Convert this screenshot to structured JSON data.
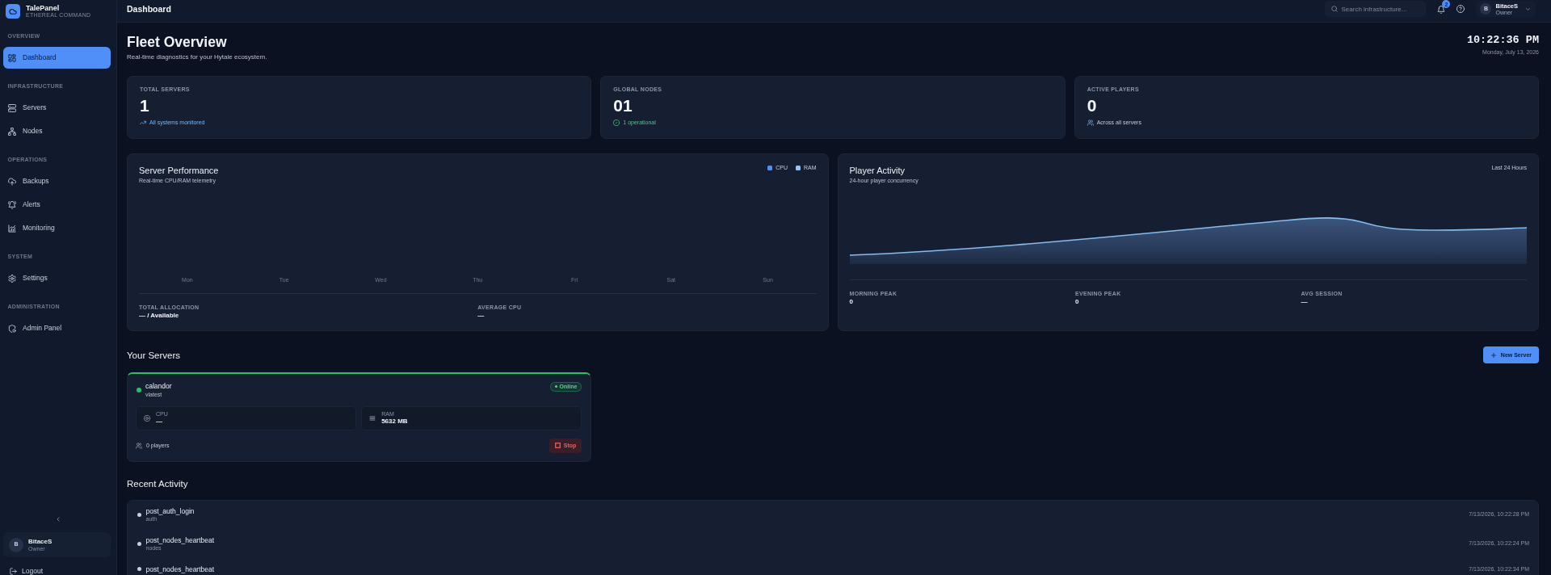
{
  "sidebar": {
    "brand": {
      "name": "TalePanel",
      "tagline": "ETHEREAL COMMAND"
    },
    "sections": [
      {
        "label": "OVERVIEW",
        "items": [
          {
            "label": "Dashboard",
            "kind": "dashboard",
            "selected": true
          }
        ]
      },
      {
        "label": "INFRASTRUCTURE",
        "items": [
          {
            "label": "Servers",
            "kind": "servers",
            "selected": false
          },
          {
            "label": "Nodes",
            "kind": "nodes",
            "selected": false
          }
        ]
      },
      {
        "label": "OPERATIONS",
        "items": [
          {
            "label": "Backups",
            "kind": "backups",
            "selected": false
          },
          {
            "label": "Alerts",
            "kind": "alerts",
            "selected": false
          },
          {
            "label": "Monitoring",
            "kind": "monitoring",
            "selected": false
          }
        ]
      },
      {
        "label": "SYSTEM",
        "items": [
          {
            "label": "Settings",
            "kind": "settings",
            "selected": false
          }
        ]
      },
      {
        "label": "ADMINISTRATION",
        "items": [
          {
            "label": "Admin Panel",
            "kind": "admin",
            "selected": false
          }
        ]
      }
    ],
    "user": {
      "initial": "B",
      "name": "BitaceS",
      "role": "Owner"
    },
    "logout": "Logout"
  },
  "topbar": {
    "title": "Dashboard",
    "search": {
      "placeholder": "Search infrastructure..."
    },
    "notifications": {
      "badge": "2"
    },
    "user": {
      "initial": "B",
      "name": "BitaceS",
      "role": "Owner"
    }
  },
  "header": {
    "title": "Fleet Overview",
    "subtitle": "Real-time diagnostics for your Hytale ecosystem.",
    "clock": {
      "time": "10:22:36 PM",
      "date": "Monday, July 13, 2026"
    }
  },
  "stats": [
    {
      "label": "TOTAL SERVERS",
      "value": "1",
      "note": "All systems monitored",
      "kind": "trend"
    },
    {
      "label": "GLOBAL NODES",
      "value": "01",
      "note": "1 operational",
      "kind": "check"
    },
    {
      "label": "ACTIVE PLAYERS",
      "value": "0",
      "note": "Across all servers",
      "kind": "users"
    }
  ],
  "server_performance": {
    "title": "Server Performance",
    "subtitle": "Real-time CPU/RAM telemetry",
    "legend": [
      {
        "label": "CPU",
        "color": "#4f8ff7"
      },
      {
        "label": "RAM",
        "color": "#93c5fd"
      }
    ],
    "day_labels": [
      "Mon",
      "Tue",
      "Wed",
      "Thu",
      "Fri",
      "Sat",
      "Sun"
    ],
    "stats": [
      {
        "label": "TOTAL ALLOCATION",
        "value": "— / Available"
      },
      {
        "label": "AVERAGE CPU",
        "value": "—"
      }
    ]
  },
  "player_activity": {
    "title": "Player Activity",
    "subtitle": "24-hour player concurrency",
    "range": "Last 24 Hours",
    "stats": [
      {
        "label": "MORNING PEAK",
        "value": "0"
      },
      {
        "label": "EVENING PEAK",
        "value": "0"
      },
      {
        "label": "AVG SESSION",
        "value": "—"
      }
    ]
  },
  "servers_section": {
    "title": "Your Servers",
    "new_button": "New Server",
    "servers": [
      {
        "name": "calandor",
        "version": "vlatest",
        "online": true,
        "status": "Online",
        "metrics": [
          {
            "kind": "cpu",
            "label": "CPU",
            "value": "—"
          },
          {
            "kind": "ram",
            "label": "RAM",
            "value": "5632 MB"
          }
        ],
        "players": "0 players",
        "action": "Stop"
      }
    ]
  },
  "recent_activity": {
    "title": "Recent Activity",
    "events": [
      {
        "action": "post_auth_login",
        "category": "auth",
        "time": "7/13/2026, 10:22:28 PM"
      },
      {
        "action": "post_nodes_heartbeat",
        "category": "nodes",
        "time": "7/13/2026, 10:22:24 PM"
      },
      {
        "action": "post_nodes_heartbeat",
        "time": "7/13/2026, 10:22:34 PM"
      }
    ]
  }
}
